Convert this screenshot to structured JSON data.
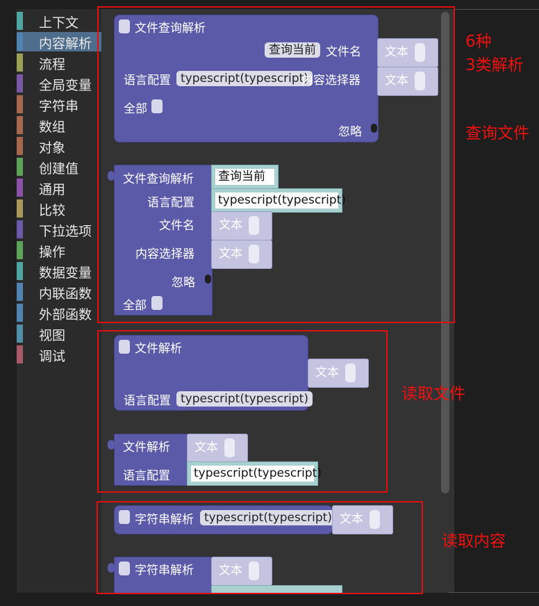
{
  "toolbox": {
    "categories": [
      {
        "label": "上下文",
        "color": "#4fa6a0"
      },
      {
        "label": "内容解析",
        "color": "#4f83b0"
      },
      {
        "label": "流程",
        "color": "#9aa055"
      },
      {
        "label": "全局变量",
        "color": "#7a58a8"
      },
      {
        "label": "字符串",
        "color": "#a86850"
      },
      {
        "label": "数组",
        "color": "#a86850"
      },
      {
        "label": "对象",
        "color": "#a86850"
      },
      {
        "label": "创建值",
        "color": "#5ea35a"
      },
      {
        "label": "通用",
        "color": "#8a52a8"
      },
      {
        "label": "比较",
        "color": "#a8985a"
      },
      {
        "label": "下拉选项",
        "color": "#6b5aa8"
      },
      {
        "label": "操作",
        "color": "#5ea35a"
      },
      {
        "label": "数据变量",
        "color": "#4fa6a0"
      },
      {
        "label": "内联函数",
        "color": "#4f83b0"
      },
      {
        "label": "外部函数",
        "color": "#4f83b0"
      },
      {
        "label": "视图",
        "color": "#4f8fa8"
      },
      {
        "label": "调试",
        "color": "#a85a68"
      }
    ]
  },
  "blocks": {
    "file_query_1": {
      "title": "文件查询解析",
      "query_current": "查询当前",
      "file_name": "文件名",
      "lang_config": "语言配置",
      "lang_value": "typescript(typescript)",
      "content_selector": "内容选择器",
      "all": "全部",
      "ignore": "忽略",
      "text_a": "文本",
      "text_b": "文本"
    },
    "file_query_2": {
      "title": "文件查询解析",
      "query_current": "查询当前",
      "lang_config": "语言配置",
      "lang_value": "typescript(typescript)",
      "file_name": "文件名",
      "text_a": "文本",
      "content_selector": "内容选择器",
      "text_b": "文本",
      "ignore": "忽略",
      "all": "全部"
    },
    "file_parse_1": {
      "title": "文件解析",
      "text": "文本",
      "lang_config": "语言配置",
      "lang_value": "typescript(typescript)"
    },
    "file_parse_2": {
      "title": "文件解析",
      "text": "文本",
      "lang_config": "语言配置",
      "lang_value": "typescript(typescript)"
    },
    "string_parse_1": {
      "title": "字符串解析",
      "lang_value": "typescript(typescript)",
      "text": "文本"
    },
    "string_parse_2": {
      "title": "字符串解析",
      "text": "文本"
    }
  },
  "annotations": {
    "six_kinds": "6种",
    "three_types": "3类解析",
    "query_file": "查询文件",
    "read_file": "读取文件",
    "read_content": "读取内容",
    "color": "#ee1111"
  }
}
